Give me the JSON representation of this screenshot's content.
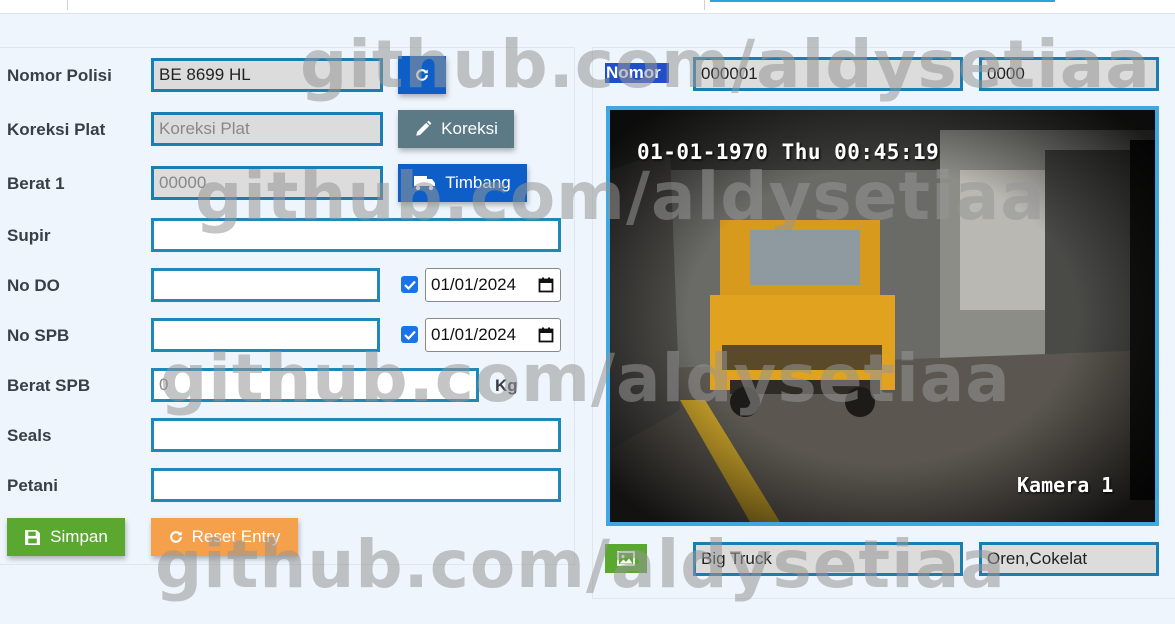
{
  "form": {
    "nomor_polisi": {
      "label": "Nomor Polisi",
      "value": "BE 8699 HL"
    },
    "koreksi_plat": {
      "label": "Koreksi Plat",
      "placeholder": "Koreksi Plat"
    },
    "berat1": {
      "label": "Berat 1",
      "value": "00000"
    },
    "supir": {
      "label": "Supir",
      "value": ""
    },
    "no_do": {
      "label": "No DO",
      "value": "",
      "checked": true,
      "date": "01/01/2024"
    },
    "no_spb": {
      "label": "No SPB",
      "value": "",
      "checked": true,
      "date": "01/01/2024"
    },
    "berat_spb": {
      "label": "Berat SPB",
      "value": "0",
      "unit": "Kg"
    },
    "seals": {
      "label": "Seals",
      "value": ""
    },
    "petani": {
      "label": "Petani",
      "value": ""
    }
  },
  "buttons": {
    "koreksi": "Koreksi",
    "timbang": "Timbang",
    "simpan": "Simpan",
    "reset": "Reset Entry"
  },
  "right": {
    "nomor_label": "Nomor",
    "nomor_value": "000001",
    "nomor_code": "0000",
    "vehicle_type": "Big Truck",
    "vehicle_color": "Oren,Cokelat"
  },
  "camera": {
    "timestamp": "01-01-1970 Thu 00:45:19",
    "name": "Kamera 1"
  },
  "watermark": "github.com/aldysetiaa",
  "colors": {
    "input_border": "#1f88b8",
    "refresh_button": "#0d5fc7",
    "koreksi_button": "#5b7a86",
    "timbang_button": "#0d5fc7",
    "simpan_button": "#5aa830",
    "reset_button": "#f5a04a",
    "camera_border": "#3fa8e0"
  },
  "icons": [
    "refresh-icon",
    "pencil-icon",
    "truck-icon",
    "save-icon",
    "reset-icon",
    "image-icon",
    "calendar-icon",
    "checkmark-icon"
  ]
}
